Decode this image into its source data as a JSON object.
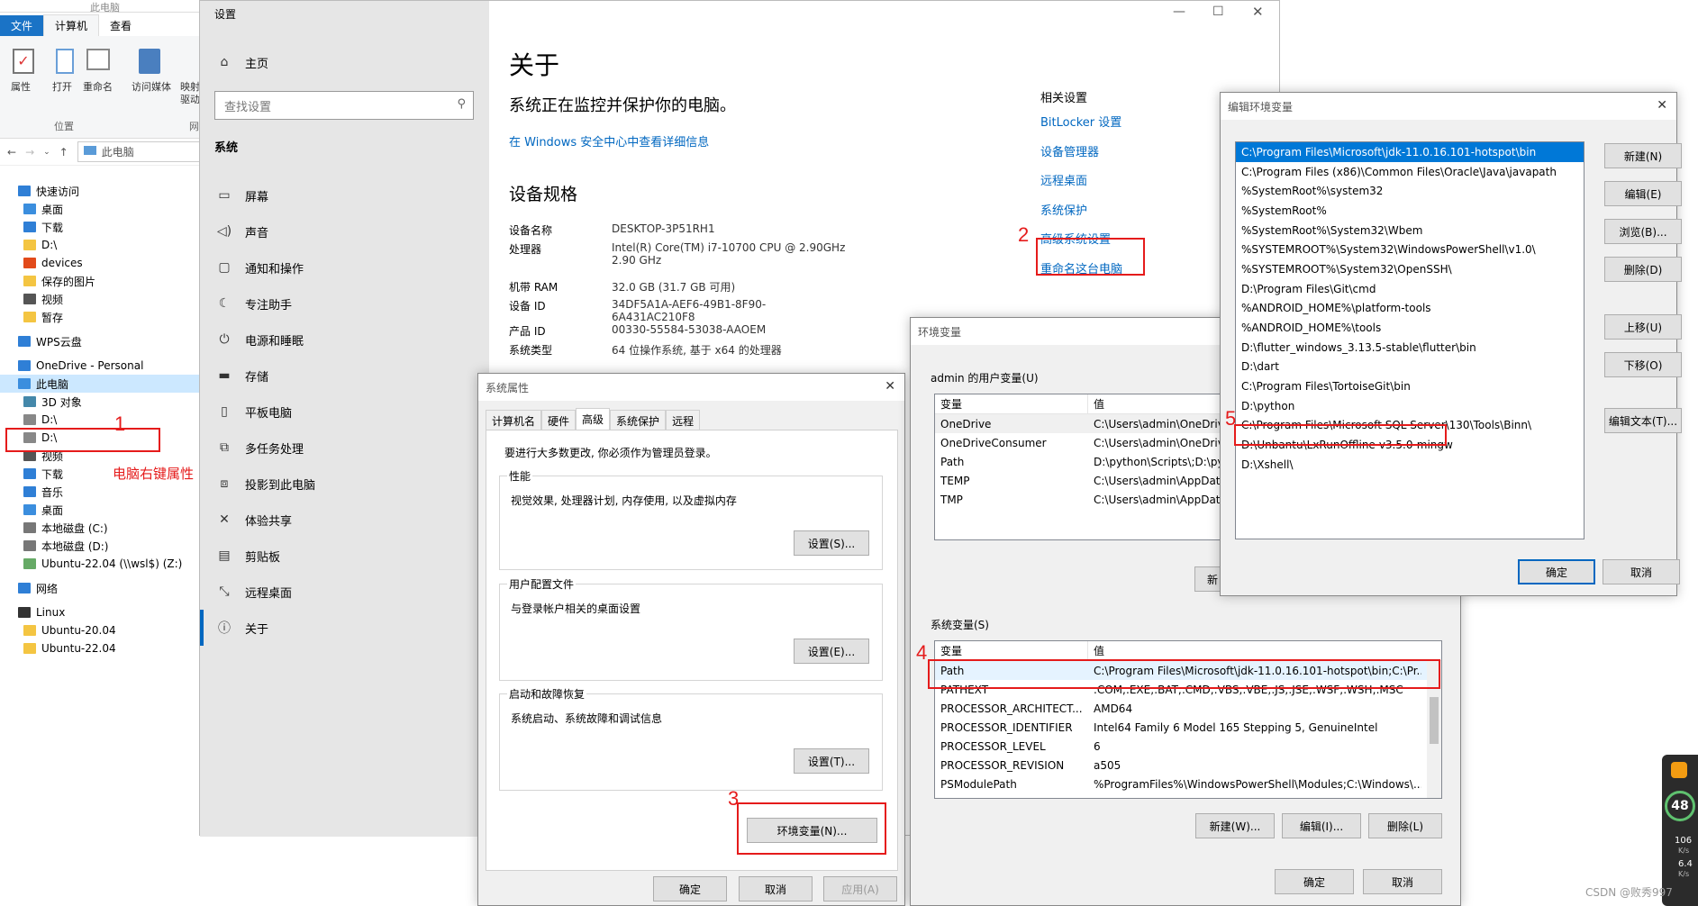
{
  "explorer": {
    "window_title": "此电脑",
    "ribbon_tabs": [
      "文件",
      "计算机",
      "查看"
    ],
    "ribbon_buttons": [
      "属性",
      "打开",
      "重命名",
      "访问媒体",
      "映射",
      "驱动"
    ],
    "ribbon_group": "位置",
    "ribbon_group2": "网",
    "address": "此电脑",
    "tree": [
      {
        "label": "快速访问",
        "icon": "star-icon",
        "indent": 1
      },
      {
        "label": "桌面",
        "icon": "desktop-icon",
        "indent": 2
      },
      {
        "label": "下载",
        "icon": "download-icon",
        "indent": 2
      },
      {
        "label": "D:\\",
        "icon": "folder-icon",
        "indent": 2
      },
      {
        "label": "devices",
        "icon": "devices-icon",
        "indent": 2
      },
      {
        "label": "保存的图片",
        "icon": "folder-icon",
        "indent": 2
      },
      {
        "label": "视频",
        "icon": "video-icon",
        "indent": 2
      },
      {
        "label": "暂存",
        "icon": "folder-icon",
        "indent": 2
      },
      {
        "label": "",
        "icon": "",
        "indent": 0
      },
      {
        "label": "WPS云盘",
        "icon": "cloud-icon",
        "indent": 1
      },
      {
        "label": "",
        "icon": "",
        "indent": 0
      },
      {
        "label": "OneDrive - Personal",
        "icon": "cloud-icon",
        "indent": 1
      },
      {
        "label": "此电脑",
        "icon": "computer-icon",
        "indent": 1,
        "selected": true
      },
      {
        "label": "3D 对象",
        "icon": "cube-icon",
        "indent": 2
      },
      {
        "label": "D:\\",
        "icon": "drive-icon",
        "indent": 2
      },
      {
        "label": "D:\\",
        "icon": "drive-icon",
        "indent": 2
      },
      {
        "label": "视频",
        "icon": "video-icon",
        "indent": 2
      },
      {
        "label": "下载",
        "icon": "download-icon",
        "indent": 2
      },
      {
        "label": "音乐",
        "icon": "music-icon",
        "indent": 2
      },
      {
        "label": "桌面",
        "icon": "desktop-icon",
        "indent": 2
      },
      {
        "label": "本地磁盘 (C:)",
        "icon": "disk-icon",
        "indent": 2
      },
      {
        "label": "本地磁盘 (D:)",
        "icon": "disk-icon",
        "indent": 2
      },
      {
        "label": "Ubuntu-22.04 (\\\\wsl$) (Z:)",
        "icon": "network-drive-icon",
        "indent": 2
      },
      {
        "label": "",
        "icon": "",
        "indent": 0
      },
      {
        "label": "网络",
        "icon": "network-icon",
        "indent": 1
      },
      {
        "label": "",
        "icon": "",
        "indent": 0
      },
      {
        "label": "Linux",
        "icon": "linux-icon",
        "indent": 1
      },
      {
        "label": "Ubuntu-20.04",
        "icon": "folder-icon",
        "indent": 2
      },
      {
        "label": "Ubuntu-22.04",
        "icon": "folder-icon",
        "indent": 2
      }
    ]
  },
  "annotations": {
    "n1": "1",
    "n2": "2",
    "n3": "3",
    "n4": "4",
    "n5": "5",
    "hint1": "电脑右键属性"
  },
  "settings": {
    "title": "设置",
    "home": "主页",
    "search_placeholder": "查找设置",
    "section": "系统",
    "nav": [
      {
        "label": "屏幕",
        "icon": "monitor-icon"
      },
      {
        "label": "声音",
        "icon": "speaker-icon"
      },
      {
        "label": "通知和操作",
        "icon": "notification-icon"
      },
      {
        "label": "专注助手",
        "icon": "moon-icon"
      },
      {
        "label": "电源和睡眠",
        "icon": "power-icon"
      },
      {
        "label": "存储",
        "icon": "storage-icon"
      },
      {
        "label": "平板电脑",
        "icon": "tablet-icon"
      },
      {
        "label": "多任务处理",
        "icon": "multitask-icon"
      },
      {
        "label": "投影到此电脑",
        "icon": "project-icon"
      },
      {
        "label": "体验共享",
        "icon": "share-icon"
      },
      {
        "label": "剪贴板",
        "icon": "clipboard-icon"
      },
      {
        "label": "远程桌面",
        "icon": "remote-icon"
      },
      {
        "label": "关于",
        "icon": "info-icon",
        "active": true
      }
    ],
    "about_title": "关于",
    "protect_text": "系统正在监控并保护你的电脑。",
    "security_link": "在 Windows 安全中心中查看详细信息",
    "spec_title": "设备规格",
    "specs": [
      {
        "k": "设备名称",
        "v": "DESKTOP-3P51RH1"
      },
      {
        "k": "处理器",
        "v": "Intel(R) Core(TM) i7-10700 CPU @ 2.90GHz   2.90 GHz"
      },
      {
        "k": "机带 RAM",
        "v": "32.0 GB (31.7 GB 可用)"
      },
      {
        "k": "设备 ID",
        "v": "34DF5A1A-AEF6-49B1-8F90-6A431AC210F8"
      },
      {
        "k": "产品 ID",
        "v": "00330-55584-53038-AAOEM"
      },
      {
        "k": "系统类型",
        "v": "64 位操作系统, 基于 x64 的处理器"
      }
    ],
    "related_title": "相关设置",
    "related": [
      "BitLocker 设置",
      "设备管理器",
      "远程桌面",
      "系统保护",
      "高级系统设置",
      "重命名这台电脑"
    ]
  },
  "sysprops": {
    "title": "系统属性",
    "tabs": [
      "计算机名",
      "硬件",
      "高级",
      "系统保护",
      "远程"
    ],
    "admin_note": "要进行大多数更改, 你必须作为管理员登录。",
    "perf_label": "性能",
    "perf_text": "视觉效果, 处理器计划, 内存使用, 以及虚拟内存",
    "perf_btn": "设置(S)...",
    "profile_label": "用户配置文件",
    "profile_text": "与登录帐户相关的桌面设置",
    "profile_btn": "设置(E)...",
    "startup_label": "启动和故障恢复",
    "startup_text": "系统启动、系统故障和调试信息",
    "startup_btn": "设置(T)...",
    "env_btn": "环境变量(N)...",
    "ok": "确定",
    "cancel": "取消",
    "apply": "应用(A)"
  },
  "envvars": {
    "title": "环境变量",
    "user_label": "admin 的用户变量(U)",
    "col_var": "变量",
    "col_val": "值",
    "user_vars": [
      {
        "k": "OneDrive",
        "v": "C:\\Users\\admin\\OneDrive"
      },
      {
        "k": "OneDriveConsumer",
        "v": "C:\\Users\\admin\\OneDrive"
      },
      {
        "k": "Path",
        "v": "D:\\python\\Scripts\\;D:\\pyt"
      },
      {
        "k": "TEMP",
        "v": "C:\\Users\\admin\\AppData"
      },
      {
        "k": "TMP",
        "v": "C:\\Users\\admin\\AppData"
      }
    ],
    "user_new_btn": "新",
    "sys_label": "系统变量(S)",
    "sys_vars": [
      {
        "k": "Path",
        "v": "C:\\Program Files\\Microsoft\\jdk-11.0.16.101-hotspot\\bin;C:\\Pr..."
      },
      {
        "k": "PATHEXT",
        "v": ".COM;.EXE;.BAT;.CMD;.VBS;.VBE;.JS;.JSE;.WSF;.WSH;.MSC"
      },
      {
        "k": "PROCESSOR_ARCHITECT...",
        "v": "AMD64"
      },
      {
        "k": "PROCESSOR_IDENTIFIER",
        "v": "Intel64 Family 6 Model 165 Stepping 5, GenuineIntel"
      },
      {
        "k": "PROCESSOR_LEVEL",
        "v": "6"
      },
      {
        "k": "PROCESSOR_REVISION",
        "v": "a505"
      },
      {
        "k": "PSModulePath",
        "v": "%ProgramFiles%\\WindowsPowerShell\\Modules;C:\\Windows\\..."
      }
    ],
    "new_btn": "新建(W)...",
    "edit_btn": "编辑(I)...",
    "del_btn": "删除(L)",
    "ok": "确定",
    "cancel": "取消"
  },
  "editenv": {
    "title": "编辑环境变量",
    "paths": [
      "C:\\Program Files\\Microsoft\\jdk-11.0.16.101-hotspot\\bin",
      "C:\\Program Files (x86)\\Common Files\\Oracle\\Java\\javapath",
      "%SystemRoot%\\system32",
      "%SystemRoot%",
      "%SystemRoot%\\System32\\Wbem",
      "%SYSTEMROOT%\\System32\\WindowsPowerShell\\v1.0\\",
      "%SYSTEMROOT%\\System32\\OpenSSH\\",
      "D:\\Program Files\\Git\\cmd",
      "%ANDROID_HOME%\\platform-tools",
      "%ANDROID_HOME%\\tools",
      "D:\\flutter_windows_3.13.5-stable\\flutter\\bin",
      "D:\\dart",
      "C:\\Program Files\\TortoiseGit\\bin",
      "D:\\python",
      "C:\\Program Files\\Microsoft SQL Server\\130\\Tools\\Binn\\",
      "D:\\Unbantu\\LxRunOffline-v3.5.0-mingw",
      "D:\\Xshell\\"
    ],
    "buttons": [
      "新建(N)",
      "编辑(E)",
      "浏览(B)...",
      "删除(D)",
      "上移(U)",
      "下移(O)",
      "编辑文本(T)..."
    ],
    "ok": "确定",
    "cancel": "取消"
  },
  "widget": {
    "percent": "48",
    "up": "106",
    "up_unit": "K/s",
    "down": "6.4",
    "down_unit": "K/s"
  },
  "watermark": "CSDN @败秀997",
  "colors": {
    "accent": "#0067c0",
    "annotation": "#e51b1b",
    "selection": "#cce8ff"
  }
}
